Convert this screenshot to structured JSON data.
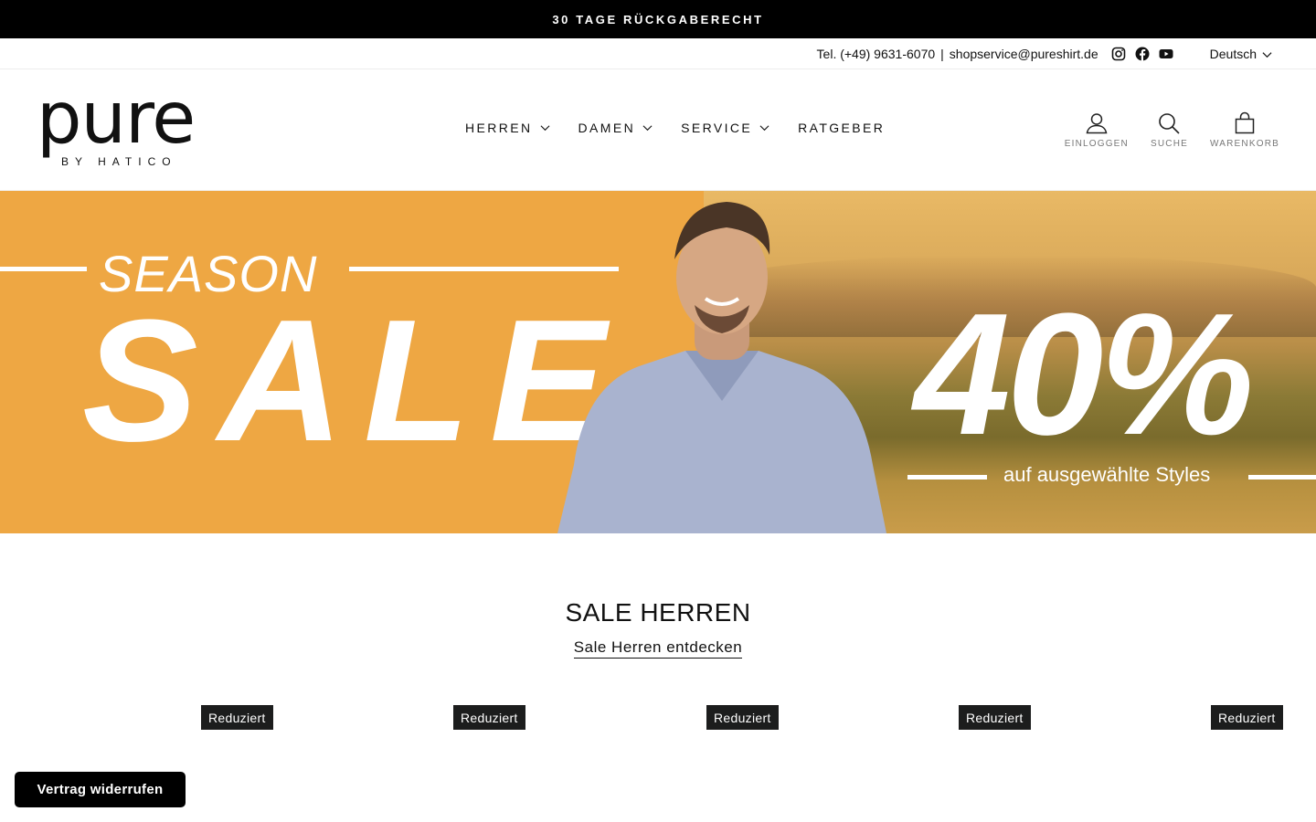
{
  "announcement": "30 TAGE RÜCKGABERECHT",
  "utility": {
    "phone": "Tel. (+49) 9631-6070",
    "separator": "|",
    "email": "shopservice@pureshirt.de",
    "social": [
      "instagram-icon",
      "facebook-icon",
      "youtube-icon"
    ],
    "language": "Deutsch"
  },
  "logo": {
    "word": "pure",
    "sub": "BY HATICO"
  },
  "nav": [
    {
      "label": "HERREN",
      "has_dropdown": true
    },
    {
      "label": "DAMEN",
      "has_dropdown": true
    },
    {
      "label": "SERVICE",
      "has_dropdown": true
    },
    {
      "label": "RATGEBER",
      "has_dropdown": false
    }
  ],
  "header_actions": [
    {
      "label": "EINLOGGEN",
      "icon": "user-icon"
    },
    {
      "label": "SUCHE",
      "icon": "search-icon"
    },
    {
      "label": "WARENKORB",
      "icon": "bag-icon"
    }
  ],
  "hero": {
    "season": "SEASON",
    "sale": "SALE",
    "percent": "40%",
    "subline": "auf ausgewählte Styles",
    "colors": {
      "orange": "#eea743"
    }
  },
  "section": {
    "title": "SALE HERREN",
    "link": "Sale Herren entdecken"
  },
  "badges": [
    "Reduziert",
    "Reduziert",
    "Reduziert",
    "Reduziert",
    "Reduziert"
  ],
  "revoke_button": "Vertrag widerrufen"
}
